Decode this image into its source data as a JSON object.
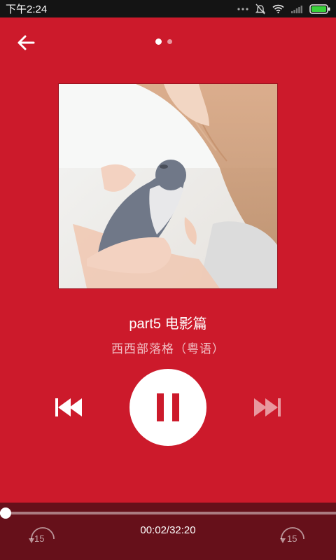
{
  "status_bar": {
    "time": "下午2:24",
    "icons": [
      "more-dots-icon",
      "alarm-off-icon",
      "wifi-icon",
      "signal-icon",
      "battery-icon"
    ]
  },
  "header": {
    "back_icon": "arrow-left-icon",
    "page_count": 2,
    "active_page": 1
  },
  "track": {
    "title": "part5 电影篇",
    "artist": "西西部落格（粤语）"
  },
  "controls": {
    "previous_icon": "previous-track-icon",
    "play_state_icon": "pause-icon",
    "next_icon": "next-track-icon"
  },
  "progress": {
    "elapsed": "00:02",
    "total": "32:20",
    "display": "00:02/32:20",
    "fraction": 0.001
  },
  "skip": {
    "back_label": "15",
    "forward_label": "15"
  },
  "colors": {
    "background": "#cc1a2b",
    "bottom_bar": "#66101a",
    "status_bar": "#141414"
  }
}
